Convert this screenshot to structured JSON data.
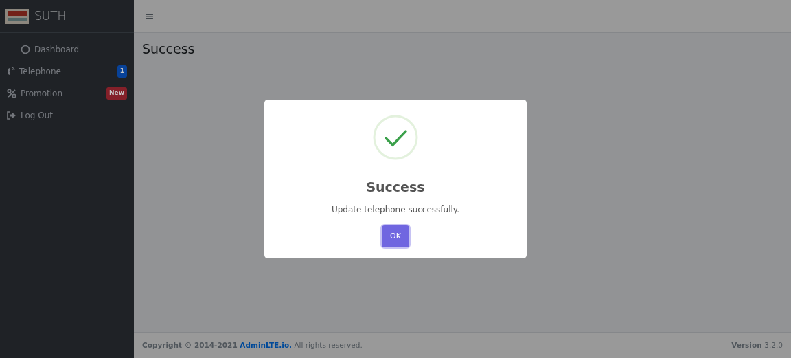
{
  "brand": {
    "name": "SUTH"
  },
  "sidebar": {
    "items": [
      {
        "label": "Dashboard"
      },
      {
        "label": "Telephone",
        "badge": {
          "text": "1",
          "color": "#084298"
        }
      },
      {
        "label": "Promotion",
        "badge": {
          "text": "New",
          "color": "#842029"
        }
      },
      {
        "label": "Log Out"
      }
    ]
  },
  "topbar": {
    "menu_toggle": "≡"
  },
  "page": {
    "title": "Success"
  },
  "footer": {
    "copyright_prefix": "Copyright © 2014-2021",
    "link": "AdminLTE.io.",
    "suffix": "All rights reserved.",
    "version_label": "Version",
    "version": "3.2.0"
  },
  "dialog": {
    "title": "Success",
    "message": "Update telephone successfully.",
    "button": "OK"
  }
}
